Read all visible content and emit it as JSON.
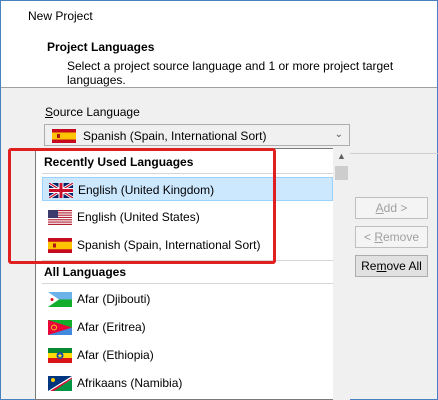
{
  "window": {
    "title": "New Project"
  },
  "header": {
    "title": "Project Languages",
    "subtitle": "Select a project source language and 1 or more project target languages."
  },
  "source_language": {
    "label_prefix": "",
    "label_accel": "S",
    "label_rest": "ource Language",
    "selected_value": "Spanish (Spain, International Sort)",
    "selected_flag": "spain-flag"
  },
  "dropdown": {
    "recent_header": "Recently Used Languages",
    "recent_items": [
      {
        "label": "English (United Kingdom)",
        "flag": "uk-flag",
        "selected": true
      },
      {
        "label": "English (United States)",
        "flag": "us-flag",
        "selected": false
      },
      {
        "label": "Spanish (Spain, International Sort)",
        "flag": "spain-flag",
        "selected": false
      }
    ],
    "all_header": "All Languages",
    "all_items": [
      {
        "label": "Afar (Djibouti)",
        "flag": "djibouti-flag"
      },
      {
        "label": "Afar (Eritrea)",
        "flag": "eritrea-flag"
      },
      {
        "label": "Afar (Ethiopia)",
        "flag": "ethiopia-flag"
      },
      {
        "label": "Afrikaans (Namibia)",
        "flag": "namibia-flag"
      }
    ]
  },
  "buttons": {
    "add": {
      "label_pre": "",
      "accel": "A",
      "label_post": "dd >"
    },
    "remove": {
      "label_pre": "< ",
      "accel": "R",
      "label_post": "emove"
    },
    "remove_all": {
      "label_pre": "Re",
      "accel": "m",
      "label_post": "ove All"
    }
  },
  "colors": {
    "highlight": "#e02020",
    "selection_bg": "#cce8ff",
    "window_border": "#4a7fc1"
  }
}
